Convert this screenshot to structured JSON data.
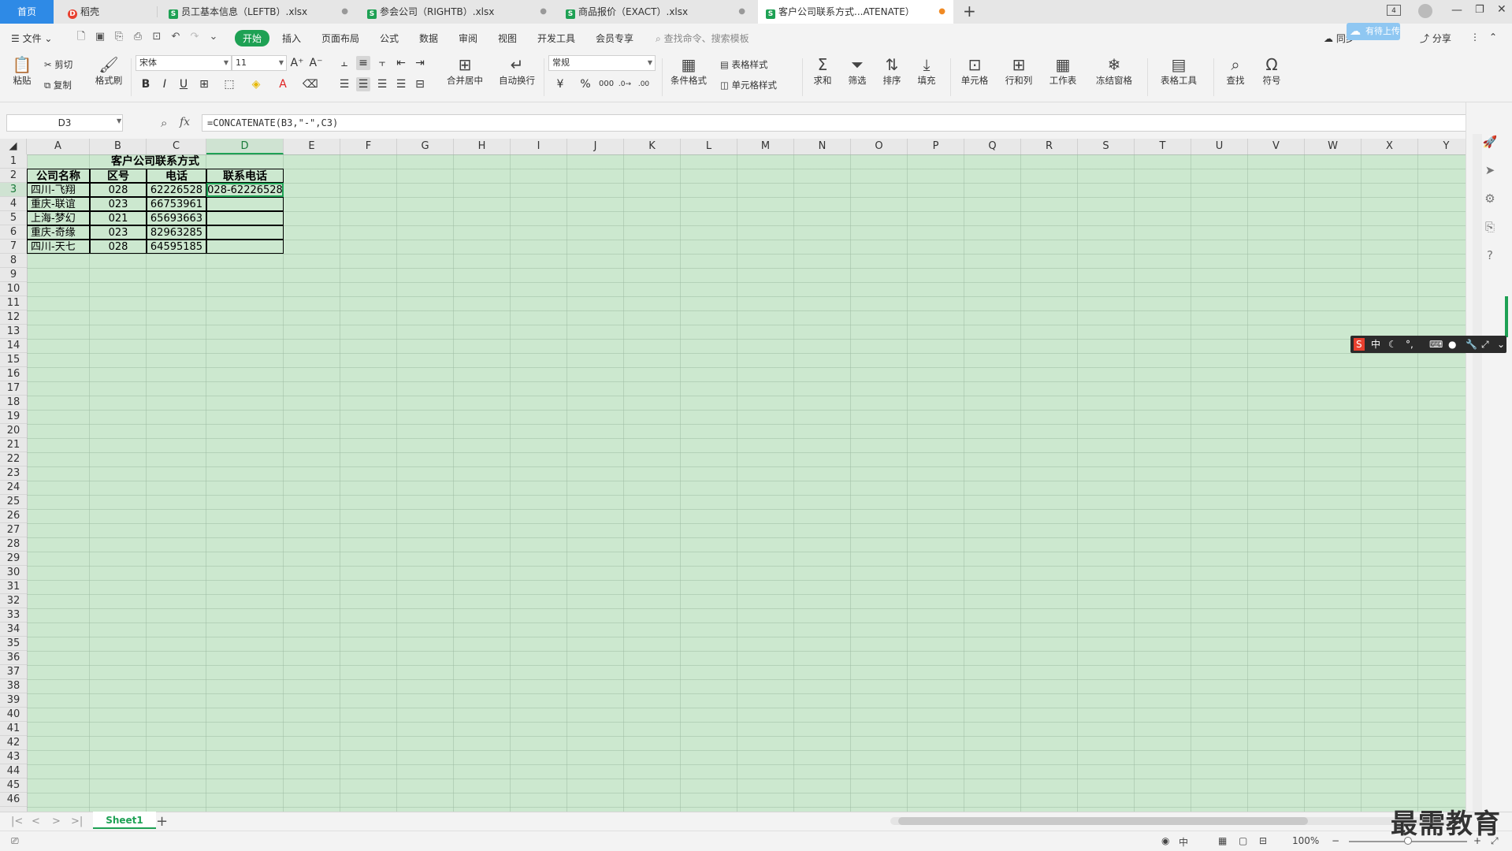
{
  "tabs": [
    {
      "label": "首页",
      "kind": "home"
    },
    {
      "label": "稻壳",
      "kind": "docer"
    },
    {
      "label": "员工基本信息（LEFTB）.xlsx",
      "kind": "sheet"
    },
    {
      "label": "参会公司（RIGHTB）.xlsx",
      "kind": "sheet"
    },
    {
      "label": "商品报价（EXACT）.xlsx",
      "kind": "sheet"
    },
    {
      "label": "客户公司联系方式...ATENATE）",
      "kind": "sheet-active"
    }
  ],
  "tab_extra": {
    "new_tab": "+",
    "window_count": "4"
  },
  "menu": {
    "file": "文件",
    "items": [
      "开始",
      "插入",
      "页面布局",
      "公式",
      "数据",
      "审阅",
      "视图",
      "开发工具",
      "会员专享"
    ],
    "active": "开始",
    "search_placeholder": "查找命令、搜索模板",
    "sync": "同步",
    "cloud": "有待上传",
    "share": "分享"
  },
  "ribbon": {
    "paste": "粘贴",
    "cut": "剪切",
    "copy": "复制",
    "format_painter": "格式刷",
    "font": "宋体",
    "font_size": "11",
    "merge_center": "合并居中",
    "wrap": "自动换行",
    "number_format": "常规",
    "cond_format": "条件格式",
    "table_style": "表格样式",
    "cell_style": "单元格样式",
    "sum": "求和",
    "filter": "筛选",
    "sort": "排序",
    "fill": "填充",
    "cell": "单元格",
    "row_col": "行和列",
    "worksheet": "工作表",
    "freeze": "冻结窗格",
    "table_tools": "表格工具",
    "find": "查找",
    "symbol": "符号"
  },
  "formula_bar": {
    "name_box": "D3",
    "fx": "fx",
    "formula": "=CONCATENATE(B3,\"-\",C3)"
  },
  "columns": [
    "A",
    "B",
    "C",
    "D",
    "E",
    "F",
    "G",
    "H",
    "I",
    "J",
    "K",
    "L",
    "M",
    "N",
    "O",
    "P",
    "Q",
    "R",
    "S",
    "T",
    "U",
    "V",
    "W",
    "X",
    "Y"
  ],
  "selected_column": "D",
  "selected_row": "3",
  "rows": [
    "1",
    "2",
    "3",
    "4",
    "5",
    "6",
    "7",
    "8",
    "9",
    "10",
    "11",
    "12",
    "13",
    "14",
    "15",
    "16",
    "17",
    "18",
    "19",
    "20",
    "21",
    "22",
    "23",
    "24",
    "25",
    "26",
    "27",
    "28",
    "29",
    "30",
    "31",
    "32",
    "33",
    "34",
    "35",
    "36",
    "37",
    "38",
    "39",
    "40",
    "41",
    "42",
    "43",
    "44",
    "45",
    "46"
  ],
  "table": {
    "title": "客户公司联系方式",
    "headers": [
      "公司名称",
      "区号",
      "电话",
      "联系电话"
    ],
    "data": [
      [
        "四川-飞翔",
        "028",
        "62226528",
        "028-62226528"
      ],
      [
        "重庆-联谊",
        "023",
        "66753961",
        ""
      ],
      [
        "上海-梦幻",
        "021",
        "65693663",
        ""
      ],
      [
        "重庆-奇缘",
        "023",
        "82963285",
        ""
      ],
      [
        "四川-天七",
        "028",
        "64595185",
        ""
      ]
    ]
  },
  "sheet_tab": "Sheet1",
  "status": {
    "zoom": "100%"
  },
  "ime": {
    "lang": "中"
  },
  "watermark": "最需教育"
}
